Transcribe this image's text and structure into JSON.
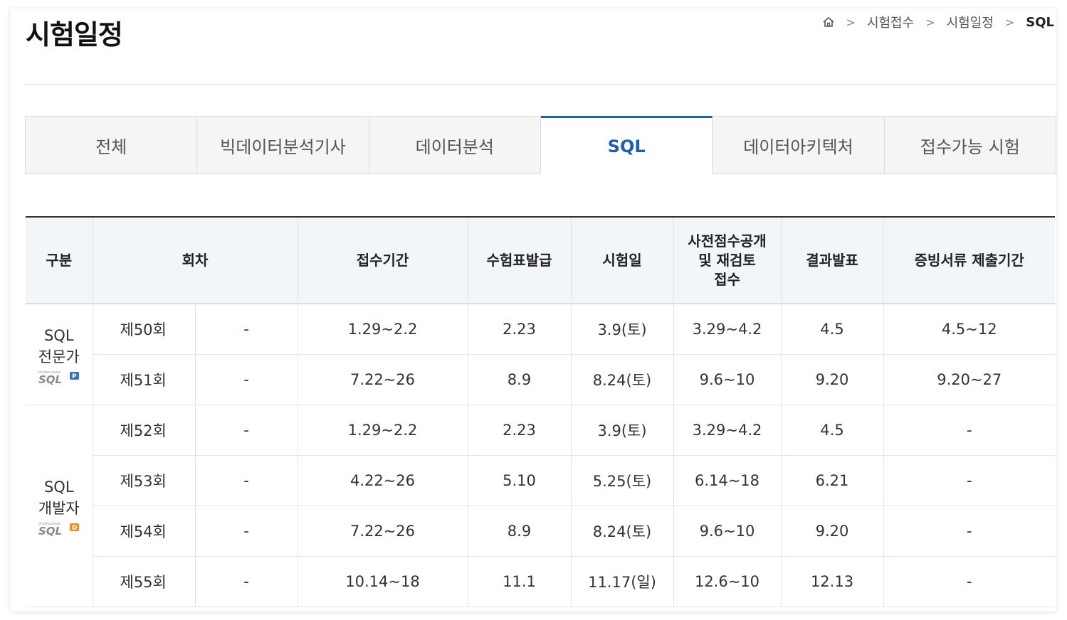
{
  "page": {
    "title": "시험일정"
  },
  "breadcrumb": {
    "home_icon": "home-icon",
    "items": [
      "시험접수",
      "시험일정",
      "SQL"
    ]
  },
  "tabs": [
    {
      "label": "전체",
      "active": false
    },
    {
      "label": "빅데이터분석기사",
      "active": false
    },
    {
      "label": "데이터분석",
      "active": false
    },
    {
      "label": "SQL",
      "active": true
    },
    {
      "label": "데이터아키텍처",
      "active": false
    },
    {
      "label": "접수가능 시험",
      "active": false
    }
  ],
  "colors": {
    "accent": "#1a5fb4",
    "header_bg": "#f3f6f8",
    "tab_bg": "#f5f5f5"
  },
  "table": {
    "headers": {
      "category": "구분",
      "round": "회차",
      "apply": "접수기간",
      "ticket": "수험표발급",
      "exam": "시험일",
      "prescore_line1": "사전점수공개",
      "prescore_line2": "및 재검토",
      "prescore_line3": "접수",
      "result": "결과발표",
      "docs": "증빙서류 제출기간"
    },
    "groups": [
      {
        "category_line1": "SQL",
        "category_line2": "전문가",
        "logo_text": "SQL",
        "logo_badge": "P",
        "logo_color": "#3a6fc2",
        "rows": [
          {
            "round": "제50회",
            "sub": "-",
            "apply": "1.29~2.2",
            "ticket": "2.23",
            "exam": "3.9(토)",
            "prescore": "3.29~4.2",
            "result": "4.5",
            "docs": "4.5~12"
          },
          {
            "round": "제51회",
            "sub": "-",
            "apply": "7.22~26",
            "ticket": "8.9",
            "exam": "8.24(토)",
            "prescore": "9.6~10",
            "result": "9.20",
            "docs": "9.20~27"
          }
        ]
      },
      {
        "category_line1": "SQL",
        "category_line2": "개발자",
        "logo_text": "SQL",
        "logo_badge": "D",
        "logo_color": "#f08a24",
        "rows": [
          {
            "round": "제52회",
            "sub": "-",
            "apply": "1.29~2.2",
            "ticket": "2.23",
            "exam": "3.9(토)",
            "prescore": "3.29~4.2",
            "result": "4.5",
            "docs": "-"
          },
          {
            "round": "제53회",
            "sub": "-",
            "apply": "4.22~26",
            "ticket": "5.10",
            "exam": "5.25(토)",
            "prescore": "6.14~18",
            "result": "6.21",
            "docs": "-"
          },
          {
            "round": "제54회",
            "sub": "-",
            "apply": "7.22~26",
            "ticket": "8.9",
            "exam": "8.24(토)",
            "prescore": "9.6~10",
            "result": "9.20",
            "docs": "-"
          },
          {
            "round": "제55회",
            "sub": "-",
            "apply": "10.14~18",
            "ticket": "11.1",
            "exam": "11.17(일)",
            "prescore": "12.6~10",
            "result": "12.13",
            "docs": "-"
          }
        ]
      }
    ]
  }
}
